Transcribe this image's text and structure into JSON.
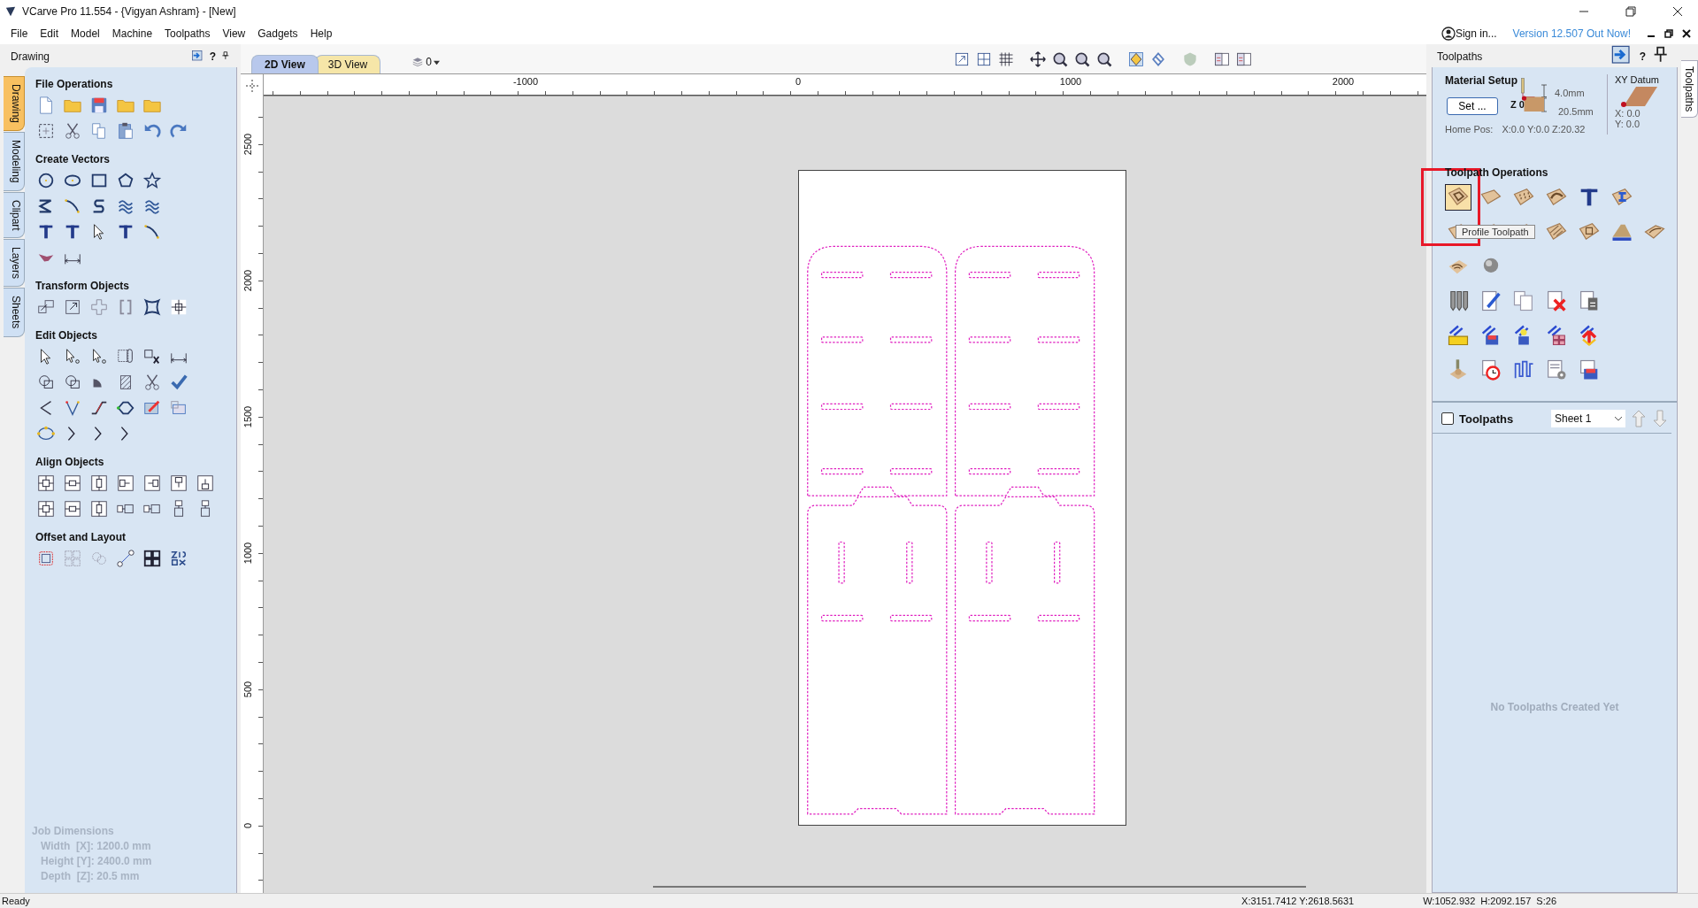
{
  "window": {
    "title": "VCarve Pro 11.554 - {Vigyan Ashram} - [New]"
  },
  "menu": [
    "File",
    "Edit",
    "Model",
    "Machine",
    "Toolpaths",
    "View",
    "Gadgets",
    "Help"
  ],
  "account": {
    "sign_in": "Sign in...",
    "update_link": "Version 12.507 Out Now!"
  },
  "drawing_panel": {
    "title": "Drawing",
    "help": "?",
    "side_tabs": [
      {
        "label": "Drawing",
        "selected": true
      },
      {
        "label": "Modeling",
        "selected": false
      },
      {
        "label": "Clipart",
        "selected": false
      },
      {
        "label": "Layers",
        "selected": false
      },
      {
        "label": "Sheets",
        "selected": false
      }
    ],
    "groups": [
      {
        "title": "File Operations"
      },
      {
        "title": "Create Vectors"
      },
      {
        "title": "Transform Objects"
      },
      {
        "title": "Edit Objects"
      },
      {
        "title": "Align Objects"
      },
      {
        "title": "Offset and Layout"
      }
    ],
    "job_dimensions": {
      "title": "Job Dimensions",
      "lines": [
        "Width  [X]: 1200.0 mm",
        "Height [Y]: 2400.0 mm",
        "Depth  [Z]: 20.5 mm"
      ]
    }
  },
  "view_tabs": [
    {
      "label": "2D View",
      "selected": true
    },
    {
      "label": "3D View",
      "selected": false
    }
  ],
  "layer_dropdown": {
    "value": "0"
  },
  "rulers": {
    "horizontal": [
      "-1000",
      "0",
      "1000",
      "2000"
    ],
    "vertical": [
      "2500",
      "2000",
      "1500",
      "1000",
      "500",
      "0"
    ]
  },
  "toolpaths_panel": {
    "title": "Toolpaths",
    "help": "?",
    "side_tab": "Toolpaths",
    "material_setup": {
      "title": "Material Setup",
      "set_button": "Set ...",
      "z_label": "Z 0",
      "clearance": "4.0mm",
      "thickness": "20.5mm",
      "home_label": "Home Pos:",
      "home_value": "X:0.0 Y:0.0 Z:20.32"
    },
    "xy_datum": {
      "title": "XY Datum",
      "x": "X: 0.0",
      "y": "Y: 0.0"
    },
    "operations_title": "Toolpath Operations",
    "tooltip": "Profile Toolpath",
    "list": {
      "checked": false,
      "label": "Toolpaths",
      "sheet": "Sheet 1",
      "empty_message": "No Toolpaths Created Yet"
    }
  },
  "status_bar": {
    "message": "Ready",
    "cursor": "X:3151.7412 Y:2618.5631",
    "selection": "W:1052.932  H:2092.157  S:26"
  }
}
